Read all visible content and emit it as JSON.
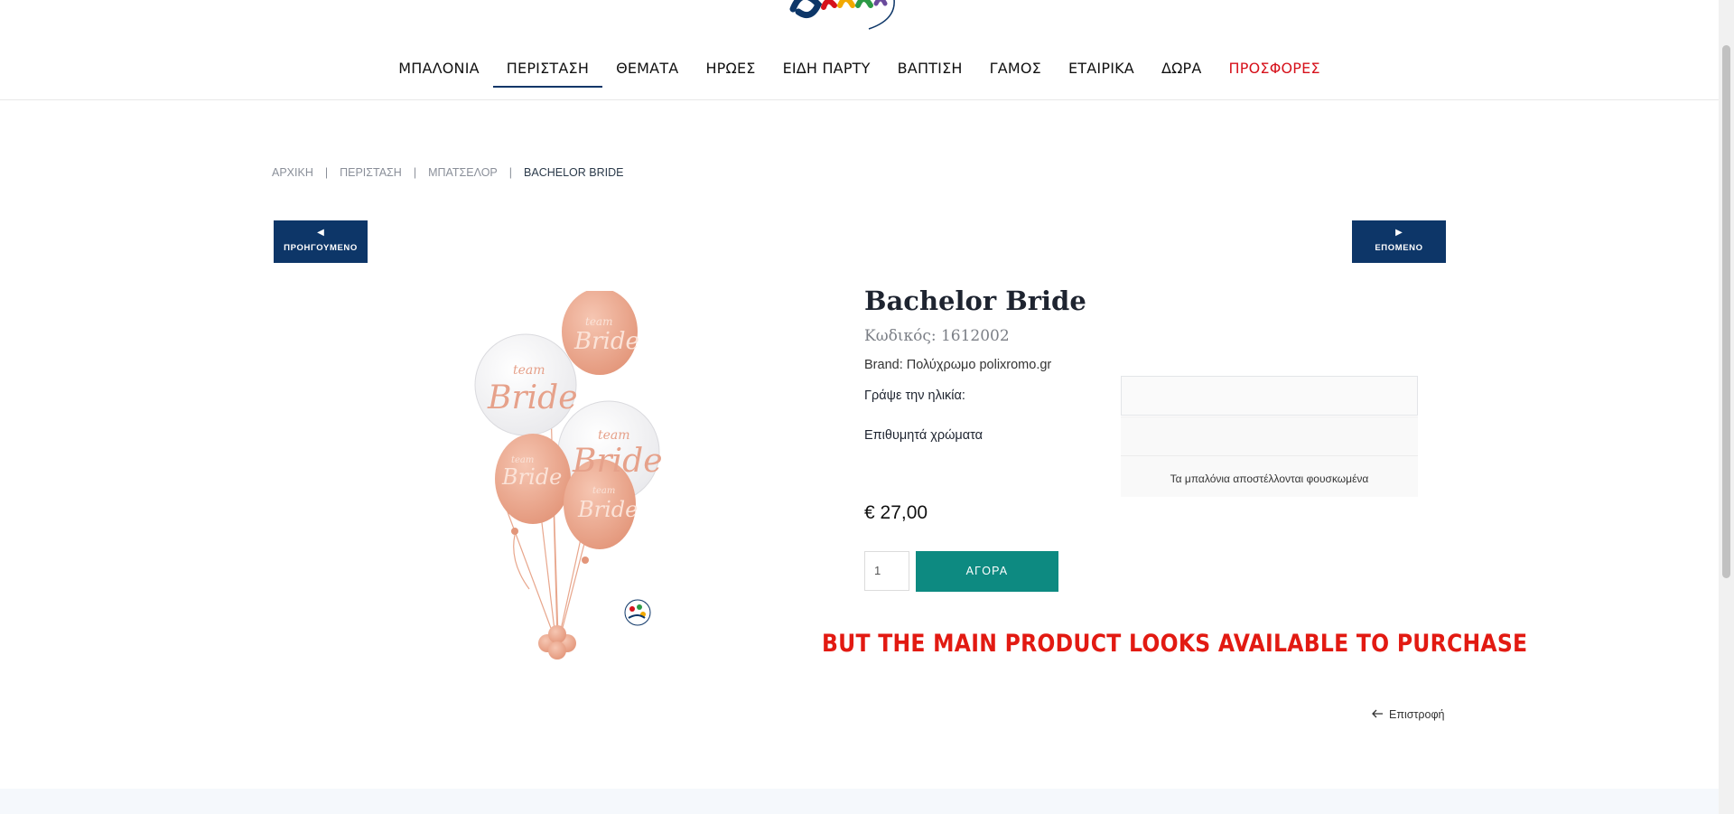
{
  "nav": {
    "items": [
      {
        "label": "ΜΠΑΛΟΝΙΑ",
        "active": false,
        "promo": false
      },
      {
        "label": "ΠΕΡΙΣΤΑΣΗ",
        "active": true,
        "promo": false
      },
      {
        "label": "ΘΕΜΑΤΑ",
        "active": false,
        "promo": false
      },
      {
        "label": "ΗΡΩΕΣ",
        "active": false,
        "promo": false
      },
      {
        "label": "ΕΙΔΗ ΠΑΡΤΥ",
        "active": false,
        "promo": false
      },
      {
        "label": "ΒΑΠΤΙΣΗ",
        "active": false,
        "promo": false
      },
      {
        "label": "ΓΑΜΟΣ",
        "active": false,
        "promo": false
      },
      {
        "label": "ΕΤΑΙΡΙΚΑ",
        "active": false,
        "promo": false
      },
      {
        "label": "ΔΩΡΑ",
        "active": false,
        "promo": false
      },
      {
        "label": "ΠΡΟΣΦΟΡΕΣ",
        "active": false,
        "promo": true
      }
    ]
  },
  "breadcrumb": {
    "home": "ΑΡΧΙΚΗ",
    "level1": "ΠΕΡΙΣΤΑΣΗ",
    "level2": "ΜΠΑΤΣΕΛΟΡ",
    "current": "BACHELOR BRIDE",
    "separator": "|"
  },
  "pager": {
    "prev_label": "ΠΡΟΗΓΟΥΜΕΝΟ",
    "next_label": "ΕΠΟΜΕΝΟ"
  },
  "product": {
    "title": "Bachelor Bride",
    "code": "Κωδικός: 1612002",
    "brand": "Brand: Πολύχρωμο polixromo.gr",
    "age_label": "Γράψε την ηλικία:",
    "age_value": "",
    "colors_label": "Επιθυμητά χρώματα",
    "inflate_note": "Τα μπαλόνια αποστέλλονται φουσκωμένα",
    "price": "€ 27,00",
    "quantity": "1",
    "buy_label": "ΑΓΟΡΑ",
    "balloon_text_top": "team",
    "balloon_text_main": "Bride"
  },
  "annotation": "BUT THE MAIN PRODUCT LOOKS AVAILABLE TO PURCHASE",
  "back_link": "Επιστροφή",
  "colors": {
    "navy": "#0d3668",
    "teal": "#0d8a81",
    "promo_red": "#d6111b",
    "annotation_red": "#e21a12",
    "rose_gold": "#e8a68c"
  }
}
